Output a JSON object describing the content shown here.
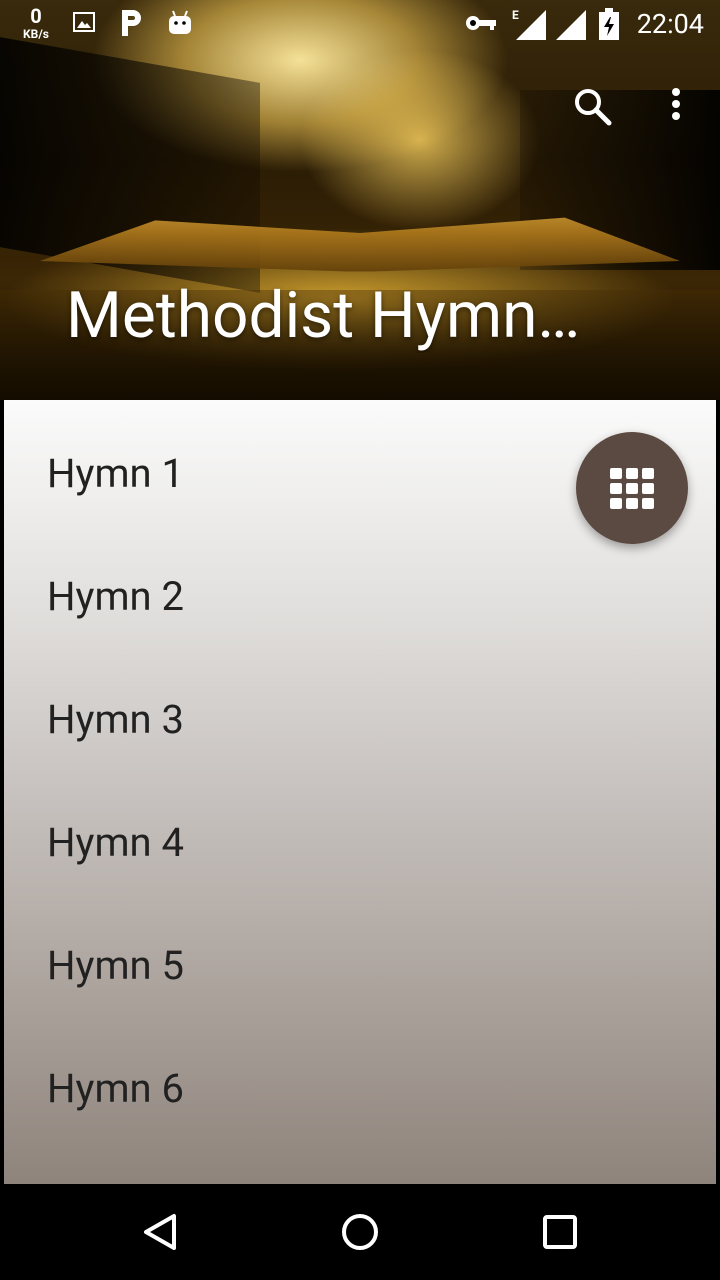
{
  "status_bar": {
    "speed_value": "0",
    "speed_unit": "KB/s",
    "network_type": "E",
    "time": "22:04",
    "icons": [
      "image-icon",
      "p-app-icon",
      "android-icon",
      "vpn-key-icon",
      "signal-e-icon",
      "signal-icon",
      "battery-charging-icon"
    ]
  },
  "toolbar": {
    "title": "Methodist Hymn…",
    "actions": [
      "search-icon",
      "more-vert-icon"
    ]
  },
  "hymns": [
    {
      "label": "Hymn 1"
    },
    {
      "label": "Hymn 2"
    },
    {
      "label": "Hymn 3"
    },
    {
      "label": "Hymn 4"
    },
    {
      "label": "Hymn 5"
    },
    {
      "label": "Hymn 6"
    }
  ],
  "fab": {
    "icon": "grid-icon",
    "color": "#5b4a41"
  },
  "nav_bar": {
    "buttons": [
      "back-icon",
      "home-icon",
      "recents-icon"
    ]
  }
}
